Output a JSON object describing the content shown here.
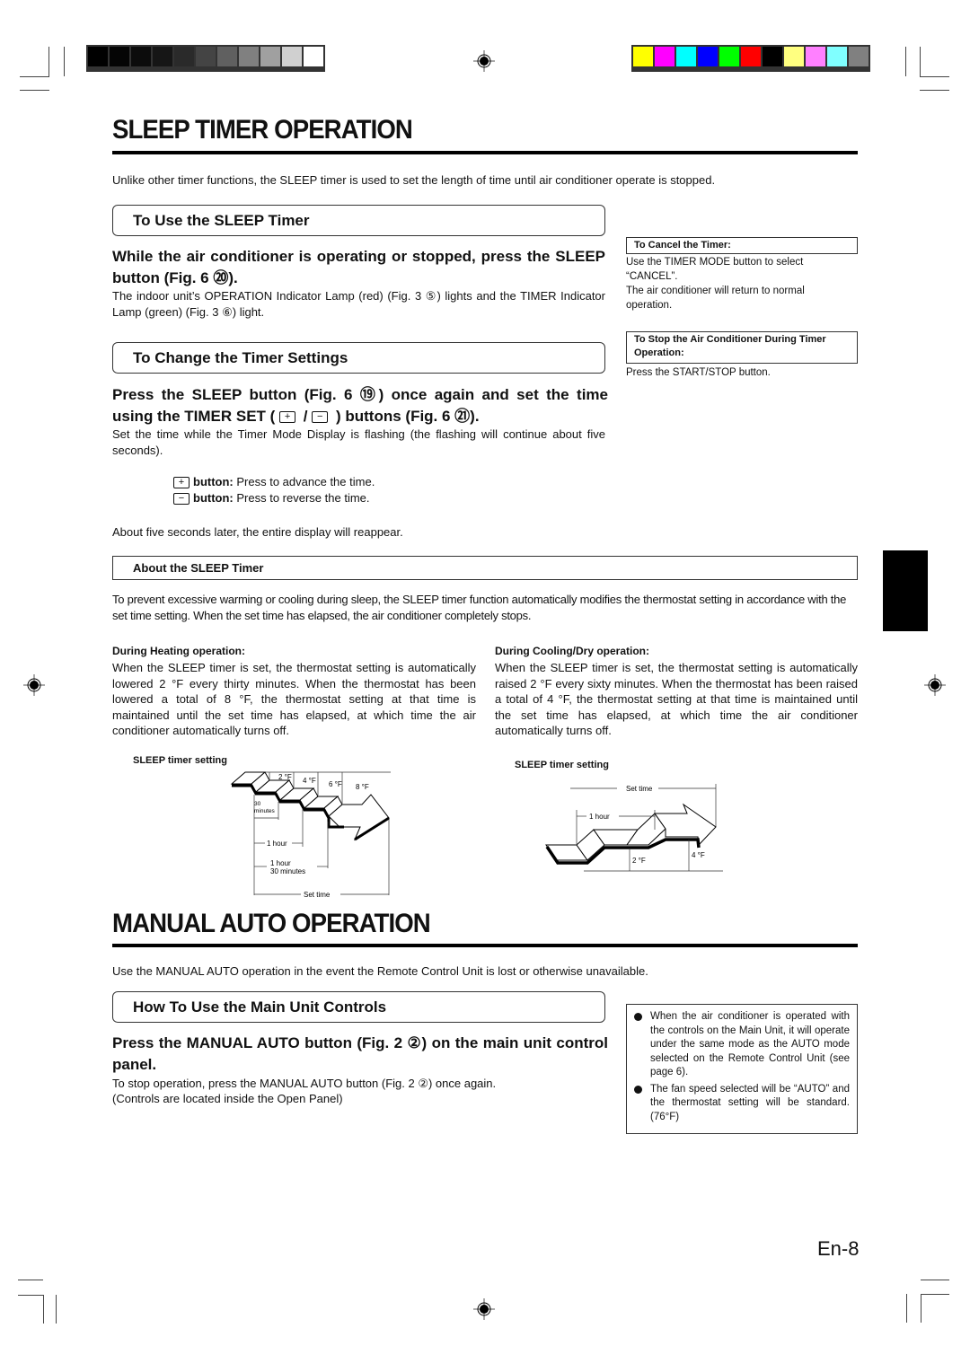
{
  "print_marks": {
    "grayscale_swatches": [
      "#000000",
      "#050505",
      "#0c0c0c",
      "#161616",
      "#2a2a2a",
      "#444444",
      "#606060",
      "#808080",
      "#a0a0a0",
      "#d0d0d0",
      "#ffffff"
    ],
    "color_swatches": [
      "#ffff00",
      "#ff00ff",
      "#00ffff",
      "#0000ff",
      "#00ff00",
      "#ff0000",
      "#000000",
      "#ffff80",
      "#ff80ff",
      "#80ffff",
      "#808080"
    ]
  },
  "sleep": {
    "title": "SLEEP TIMER OPERATION",
    "intro": "Unlike other timer functions, the SLEEP timer is used to set the length of time until air conditioner operate is stopped.",
    "use": {
      "heading": "To Use the SLEEP Timer",
      "instruction": "While the air conditioner is operating or stopped, press the SLEEP button (Fig. 6 ⑳).",
      "note": "The indoor unit’s OPERATION Indicator Lamp (red) (Fig. 3 ⑤) lights and the TIMER Indicator Lamp (green) (Fig. 3 ⑥) light."
    },
    "change": {
      "heading": "To Change the Timer Settings",
      "instruction_a": "Press the SLEEP button (Fig. 6 ⑲) once again and set the time using the TIMER SET (",
      "plus_glyph": "+",
      "slash": " / ",
      "minus_glyph": "−",
      "instruction_b": ") buttons (Fig. 6 ㉑).",
      "note": "Set the time while the Timer Mode Display is flashing (the flashing will continue about five seconds).",
      "plus_label": "button:",
      "plus_desc": "Press to advance the time.",
      "minus_label": "button:",
      "minus_desc": "Press to reverse the time.",
      "after": "About five seconds later, the entire display will reappear."
    },
    "side": {
      "cancel_heading": "To Cancel the Timer:",
      "cancel_text_1": "Use the TIMER MODE button to select “CANCEL”.",
      "cancel_text_2": "The air conditioner will return to normal operation.",
      "stop_heading": "To Stop the Air Conditioner During Timer Operation:",
      "stop_text": "Press the START/STOP button."
    },
    "about": {
      "heading": "About the SLEEP Timer",
      "text": "To prevent excessive warming or cooling during sleep, the SLEEP timer function automatically modifies the thermostat setting in accordance with the set time setting. When the set time has elapsed, the air conditioner completely stops.",
      "heating_heading": "During Heating operation:",
      "heating_text": "When the SLEEP timer is set, the thermostat setting is automatically lowered 2 °F every thirty minutes. When the thermostat has been lowered a total of 8 °F, the thermostat setting at that time is maintained until the set time has elapsed, at which time the air conditioner automatically turns off.",
      "cooling_heading": "During Cooling/Dry operation:",
      "cooling_text": "When the SLEEP timer is set, the thermostat setting is automatically raised 2 °F every sixty minutes. When the thermostat has been raised a total of 4 °F, the thermostat setting at that time is maintained until the set time has elapsed, at which time the air conditioner automatically turns off."
    },
    "diagram_heating": {
      "title": "SLEEP timer setting",
      "steps": [
        "2 °F",
        "4 °F",
        "6 °F",
        "8 °F"
      ],
      "label_30": "30",
      "label_minutes": "minutes",
      "label_1hour": "1 hour",
      "label_1h30_a": "1 hour",
      "label_1h30_b": "30 minutes",
      "label_set_time": "Set time"
    },
    "diagram_cooling": {
      "title": "SLEEP timer setting",
      "label_set_time": "Set time",
      "label_1hour": "1 hour",
      "steps": [
        "2 °F",
        "4 °F"
      ]
    }
  },
  "manual": {
    "title": "MANUAL AUTO OPERATION",
    "intro": "Use the MANUAL AUTO operation in the event the Remote Control Unit is lost or otherwise unavailable.",
    "heading": "How To Use the Main Unit Controls",
    "instruction": "Press the MANUAL AUTO button  (Fig. 2 ②) on the main unit control panel.",
    "note_1": "To stop operation, press the MANUAL AUTO button (Fig. 2 ②) once again.",
    "note_2": "(Controls are located inside the Open Panel)",
    "bullets": [
      "When the air conditioner is operated with the controls on the Main Unit, it will operate under the same mode as the AUTO mode selected on the Remote Control Unit (see page 6).",
      "The fan speed selected will be “AUTO” and the thermostat setting will be standard.(76°F)"
    ]
  },
  "page_number": "En-8"
}
